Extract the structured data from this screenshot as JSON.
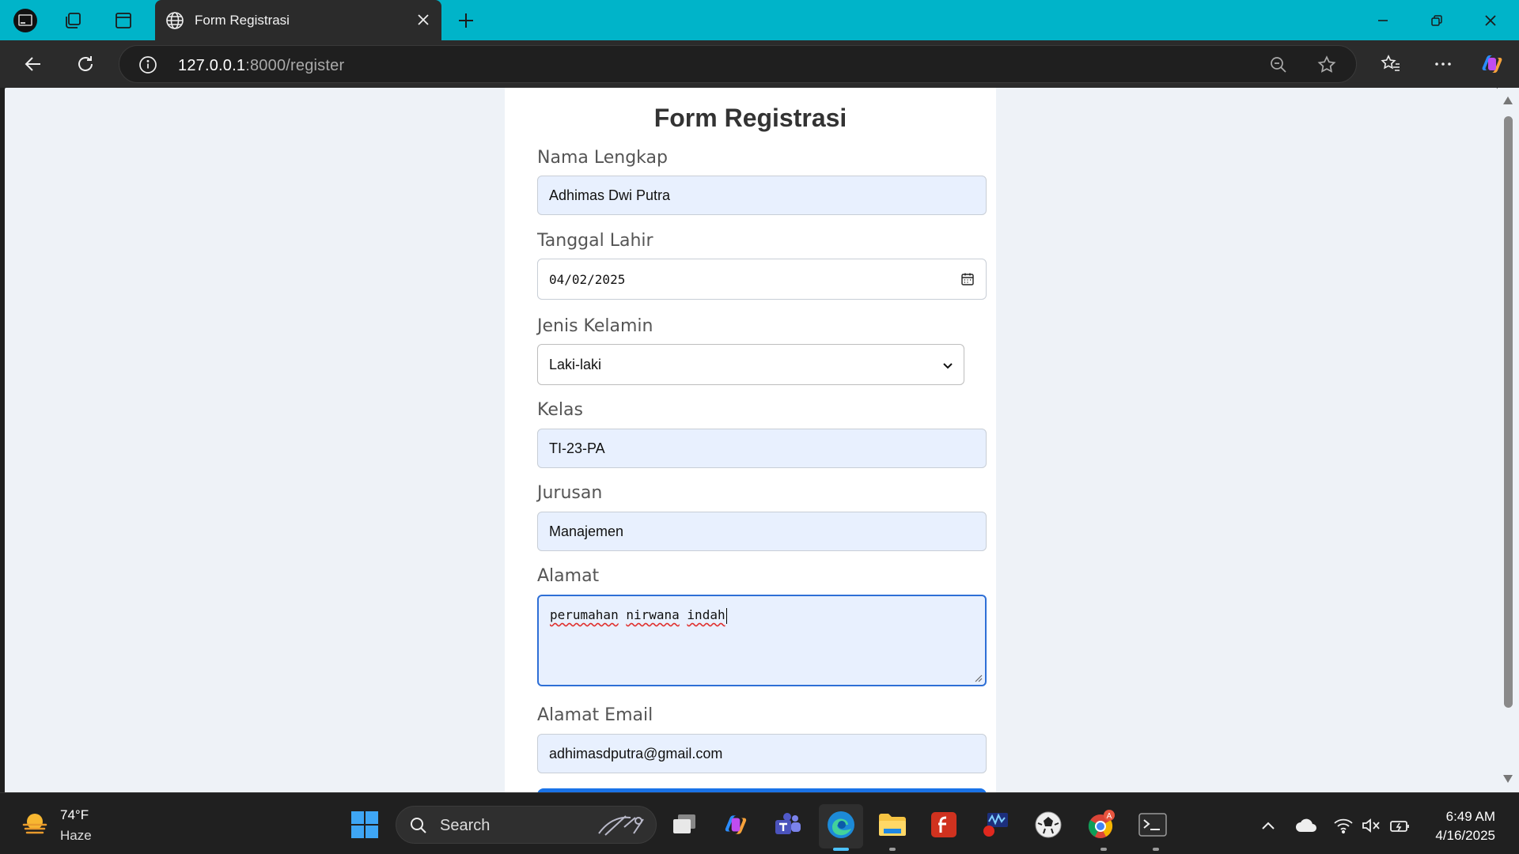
{
  "browser": {
    "tab_title": "Form Registrasi",
    "url_host": "127.0.0.1",
    "url_rest": ":8000/register"
  },
  "form": {
    "heading": "Form Registrasi",
    "nama_label": "Nama Lengkap",
    "nama_value": "Adhimas Dwi Putra",
    "tanggal_label": "Tanggal Lahir",
    "tanggal_value": "04/02/2025",
    "jenis_label": "Jenis Kelamin",
    "jenis_value": "Laki-laki",
    "kelas_label": "Kelas",
    "kelas_value": "TI-23-PA",
    "jurusan_label": "Jurusan",
    "jurusan_value": "Manajemen",
    "alamat_label": "Alamat",
    "alamat_words": [
      "perumahan",
      "nirwana",
      "indah"
    ],
    "email_label": "Alamat Email",
    "email_value": "adhimasdputra@gmail.com"
  },
  "taskbar": {
    "temperature": "74°F",
    "condition": "Haze",
    "search_label": "Search",
    "time": "6:49 AM",
    "date": "4/16/2025"
  },
  "colors": {
    "tab_strip": "#00b4c9",
    "field_bg": "#e8f0fe",
    "focus_border": "#2e6fd6",
    "page_bg": "#eef2f7"
  }
}
